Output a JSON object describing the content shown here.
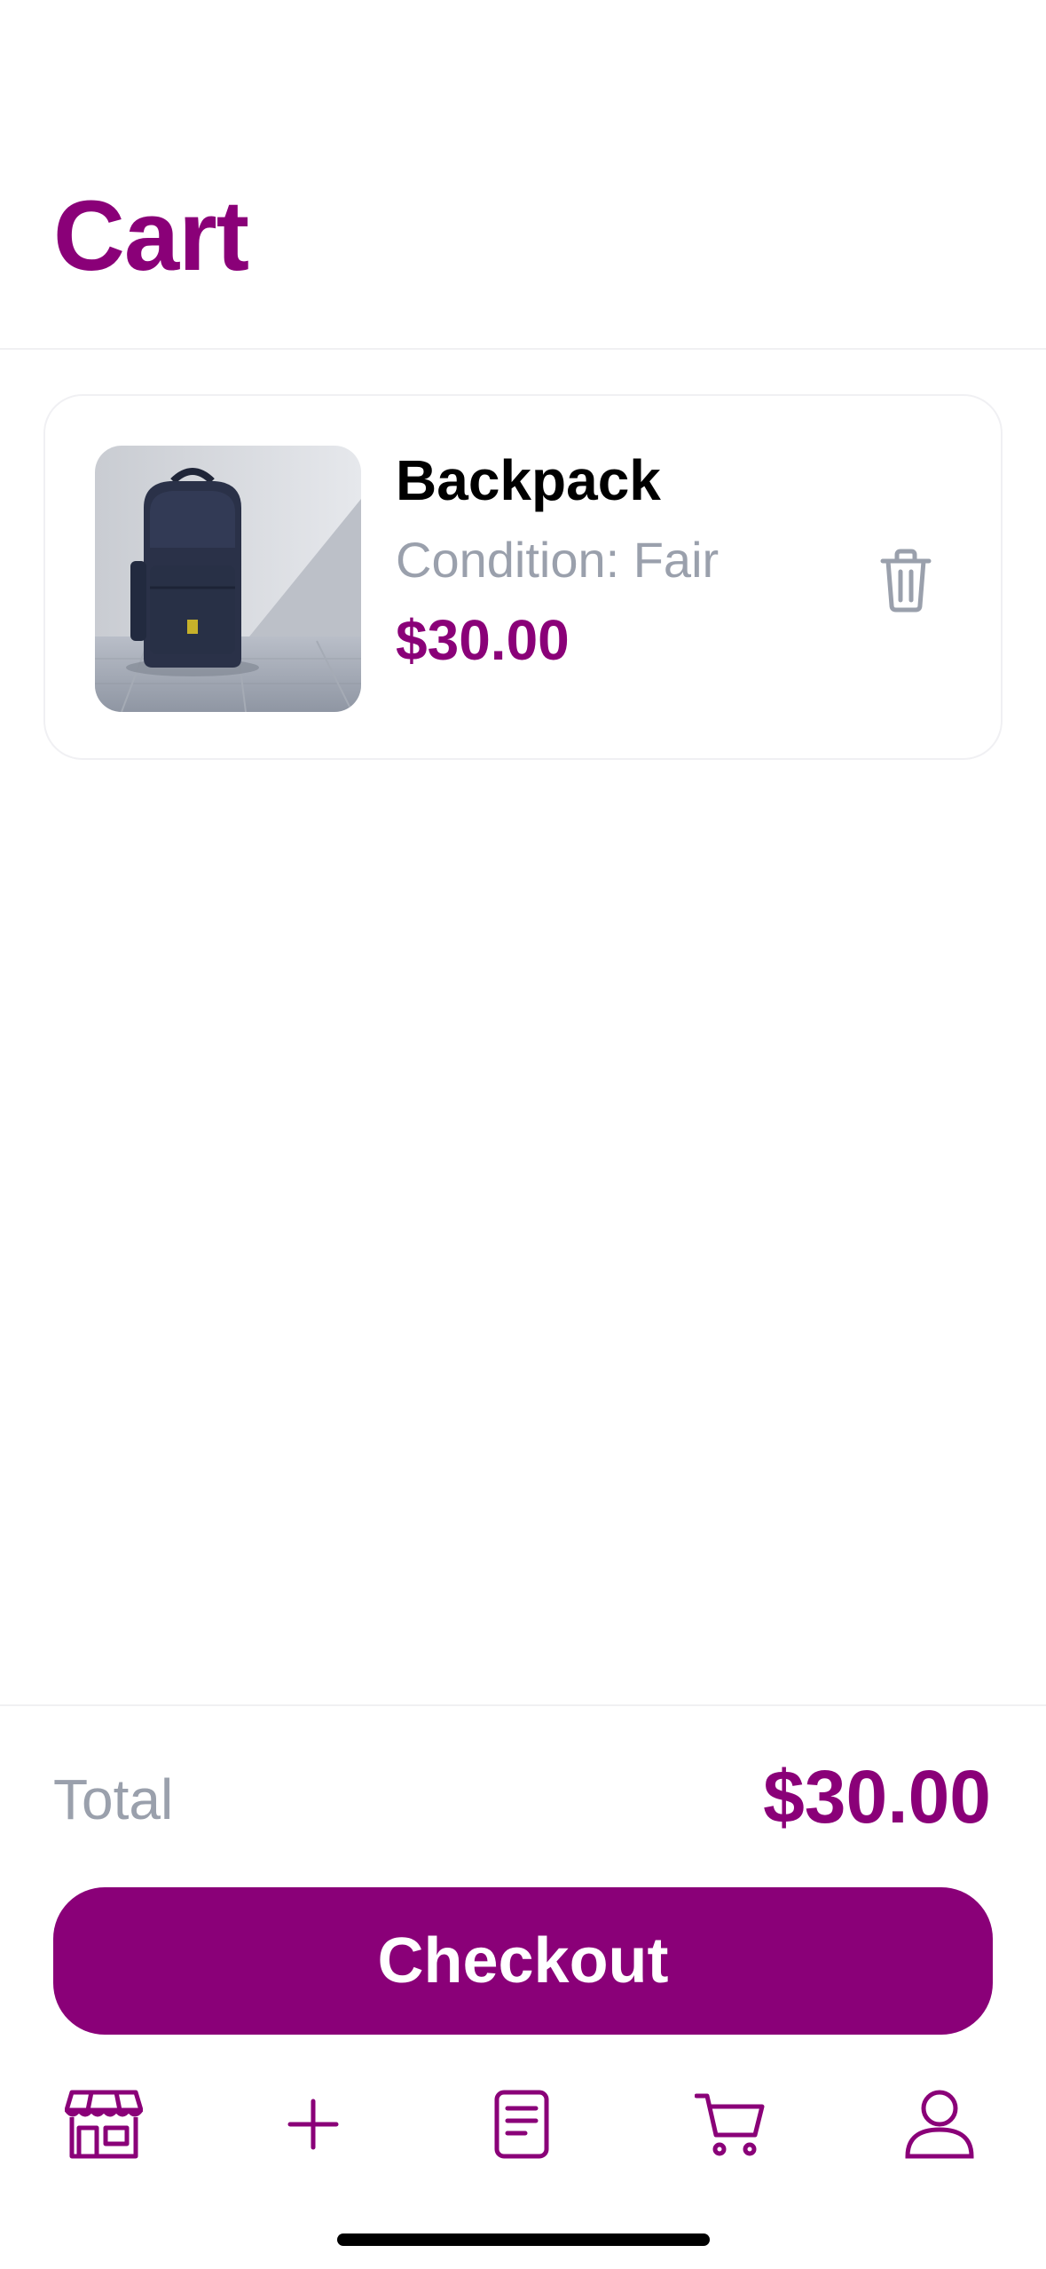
{
  "header": {
    "title": "Cart"
  },
  "cart": {
    "items": [
      {
        "name": "Backpack",
        "condition": "Condition: Fair",
        "price": "$30.00",
        "image_icon": "backpack-photo",
        "delete_icon": "trash-icon"
      }
    ]
  },
  "summary": {
    "total_label": "Total",
    "total_value": "$30.00",
    "checkout_label": "Checkout"
  },
  "tabbar": {
    "tabs": [
      {
        "icon": "store-icon"
      },
      {
        "icon": "plus-icon"
      },
      {
        "icon": "document-icon"
      },
      {
        "icon": "cart-icon"
      },
      {
        "icon": "user-icon"
      }
    ]
  },
  "colors": {
    "accent": "#8a0078",
    "muted_text": "#9aa0ac",
    "divider": "#f0f0f2"
  }
}
